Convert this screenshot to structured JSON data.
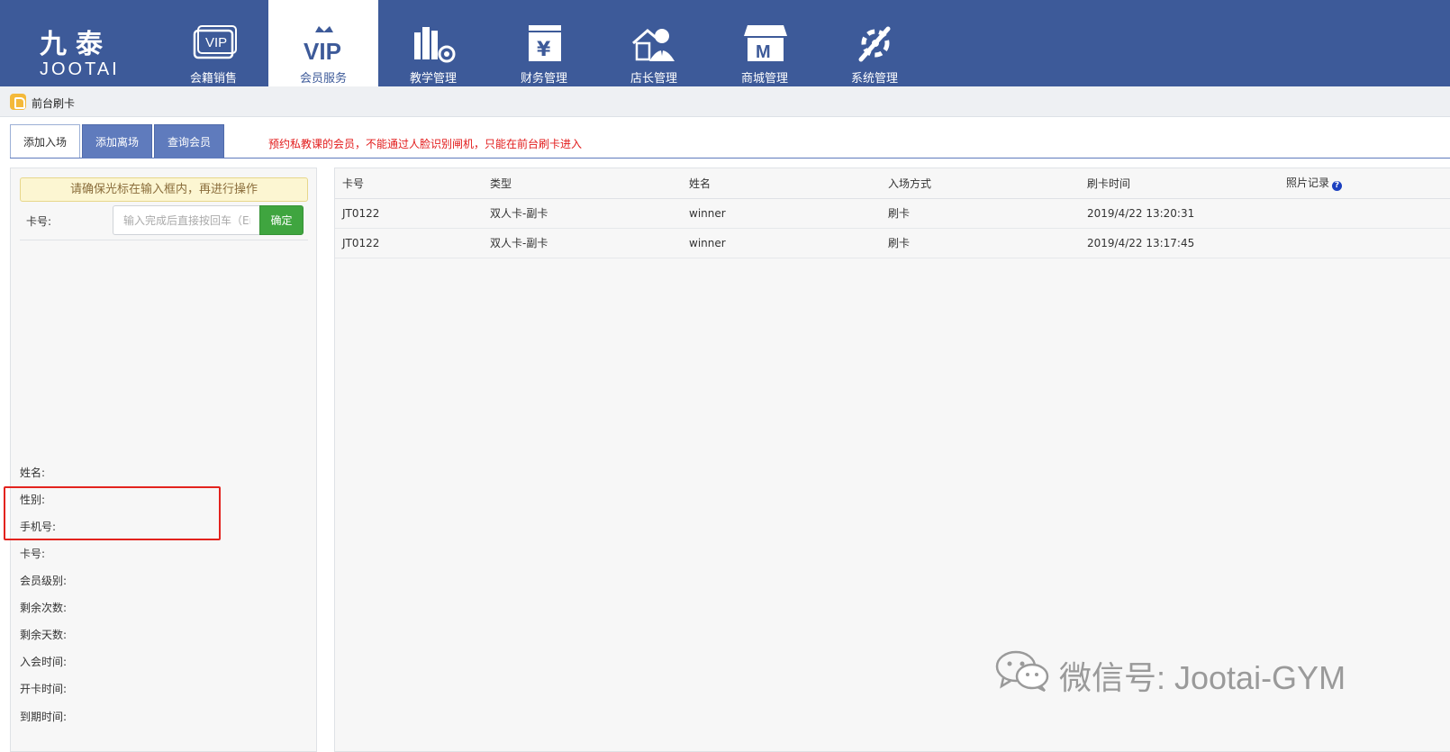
{
  "brand": {
    "name_cn": "九泰",
    "name_en": "JOOTAI"
  },
  "nav": [
    {
      "id": "vip-sales",
      "label": "会籍销售",
      "icon": "vip-card-icon",
      "active": false
    },
    {
      "id": "member-service",
      "label": "会员服务",
      "icon": "vip-crown-icon",
      "active": true
    },
    {
      "id": "teaching",
      "label": "教学管理",
      "icon": "books-gear-icon",
      "active": false
    },
    {
      "id": "finance",
      "label": "财务管理",
      "icon": "yuan-icon",
      "active": false
    },
    {
      "id": "manager",
      "label": "店长管理",
      "icon": "manager-house-icon",
      "active": false
    },
    {
      "id": "mall",
      "label": "商城管理",
      "icon": "store-icon",
      "active": false
    },
    {
      "id": "system",
      "label": "系统管理",
      "icon": "tools-icon",
      "active": false
    }
  ],
  "breadcrumb": {
    "icon": "hand-icon",
    "text": "前台刷卡"
  },
  "tabs": [
    {
      "label": "添加入场",
      "active": true
    },
    {
      "label": "添加离场",
      "active": false
    },
    {
      "label": "查询会员",
      "active": false
    }
  ],
  "notice": "预约私教课的会员，不能通过人脸识别闸机，只能在前台刷卡进入",
  "checkin": {
    "warning": "请确保光标在输入框内，再进行操作",
    "card_label": "卡号:",
    "input_placeholder": "输入完成后直接按回车（Enter）",
    "input_value": "",
    "confirm_label": "确定"
  },
  "member_info": [
    "姓名:",
    "性别:",
    "手机号:",
    "卡号:",
    "会员级别:",
    "剩余次数:",
    "剩余天数:",
    "入会时间:",
    "开卡时间:",
    "到期时间:"
  ],
  "records": {
    "columns": [
      "卡号",
      "类型",
      "姓名",
      "入场方式",
      "刷卡时间",
      "照片记录"
    ],
    "rows": [
      [
        "JT0122",
        "双人卡-副卡",
        "winner",
        "刷卡",
        "2019/4/22 13:20:31",
        ""
      ],
      [
        "JT0122",
        "双人卡-副卡",
        "winner",
        "刷卡",
        "2019/4/22 13:17:45",
        ""
      ]
    ]
  },
  "watermark": {
    "text": "微信号: Jootai-GYM",
    "icon": "wechat-icon"
  },
  "colors": {
    "nav_bg": "#3d5a99",
    "tab_bg": "#5f7bbd",
    "confirm_green": "#3fa53f",
    "notice_red": "#e21b1b",
    "highlight_red": "#e3231e"
  }
}
